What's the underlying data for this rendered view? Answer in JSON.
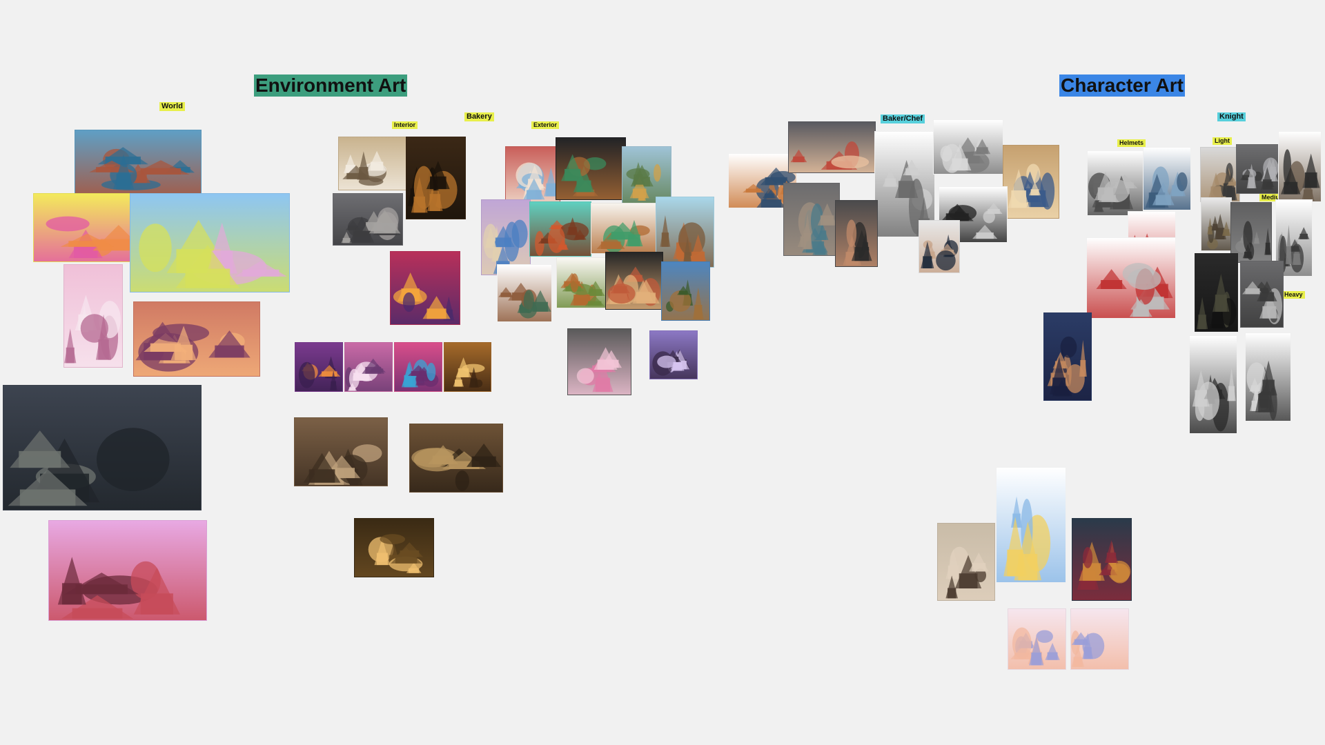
{
  "board": {
    "colors": {
      "background": "#f1f1f1",
      "heading_env": "#3d9e7e",
      "heading_char": "#3b86e6",
      "tag_yellow": "#e8ef4a",
      "tag_cyan": "#57d0dc"
    },
    "headings": {
      "environment": "Environment Art",
      "character": "Character Art"
    },
    "tags": {
      "world": "World",
      "bakery": "Bakery",
      "interior": "Interior",
      "exterior": "Exterior",
      "baker_chef": "Baker/Chef",
      "knight": "Knight",
      "helmets": "Helmets",
      "light": "Light",
      "medium": "Medium",
      "heavy": "Heavy"
    },
    "cards": {
      "world": [
        {
          "subject": "candy-island",
          "colors": [
            "#5f9fc5",
            "#2b6e94",
            "#a9553c"
          ]
        },
        {
          "subject": "cupcake-houses",
          "colors": [
            "#f3ea5c",
            "#f08c46",
            "#e25aa4"
          ]
        },
        {
          "subject": "candy-kingdom",
          "colors": [
            "#8ec6f2",
            "#e2a9d9",
            "#d6e05b"
          ]
        },
        {
          "subject": "pink-street",
          "colors": [
            "#f0c0d8",
            "#b56a92",
            "#f7e6ef"
          ]
        },
        {
          "subject": "candy-village",
          "colors": [
            "#d07a64",
            "#7a3b63",
            "#f3b07a"
          ]
        },
        {
          "subject": "dark-fantasy-city",
          "colors": [
            "#3d4450",
            "#6f7470",
            "#1f2429"
          ]
        },
        {
          "subject": "floating-dessert-island",
          "colors": [
            "#e8a9e3",
            "#6b2a3a",
            "#c74b59"
          ]
        }
      ],
      "interior": [
        {
          "subject": "bakery-layout-sketch",
          "colors": [
            "#c9b38e",
            "#6b5841",
            "#f2ebe0"
          ]
        },
        {
          "subject": "bakery-counter-dark",
          "colors": [
            "#3b2816",
            "#b8742c",
            "#1a120a"
          ]
        },
        {
          "subject": "bakery-isometric-grey",
          "colors": [
            "#6e6e72",
            "#a5a2a0",
            "#3d3d40"
          ]
        },
        {
          "subject": "pastry-shop-window",
          "colors": [
            "#b8305a",
            "#f4a63c",
            "#4b2a6b"
          ]
        },
        {
          "subject": "sweet-shop-1",
          "colors": [
            "#7a3a8e",
            "#f28e3c",
            "#3a1f4f"
          ]
        },
        {
          "subject": "sweet-shop-2",
          "colors": [
            "#c96aa6",
            "#f7e0f0",
            "#6b3b72"
          ]
        },
        {
          "subject": "sweet-shop-3",
          "colors": [
            "#d84e8a",
            "#3aa3d4",
            "#6a2d6f"
          ]
        },
        {
          "subject": "bread-shelves",
          "colors": [
            "#a56a2a",
            "#f2c470",
            "#3a2412"
          ]
        },
        {
          "subject": "bakery-map-1",
          "colors": [
            "#7b6046",
            "#c0a27d",
            "#3c2d20"
          ]
        },
        {
          "subject": "bakery-map-2",
          "colors": [
            "#6d5236",
            "#b8955f",
            "#2e2216"
          ]
        },
        {
          "subject": "cozy-bread-store",
          "colors": [
            "#3a2a14",
            "#f0c070",
            "#6a4c22"
          ]
        }
      ],
      "exterior": [
        {
          "subject": "striped-cottage",
          "colors": [
            "#c95f5a",
            "#7fb0d8",
            "#f2e3d3"
          ]
        },
        {
          "subject": "green-roof-house-dark",
          "colors": [
            "#222326",
            "#3a8b5c",
            "#a86a35"
          ]
        },
        {
          "subject": "storefront-painting",
          "colors": [
            "#9fc3d6",
            "#d2a14a",
            "#5a7a46"
          ]
        },
        {
          "subject": "fairy-castle",
          "colors": [
            "#c0a6d6",
            "#4b7fc2",
            "#e2d0b0"
          ]
        },
        {
          "subject": "orange-cottage-teal",
          "colors": [
            "#5fd0c0",
            "#d2582e",
            "#7a3a20"
          ]
        },
        {
          "subject": "green-roof-shop",
          "colors": [
            "#f7f4ee",
            "#3f9c6a",
            "#b06a32"
          ]
        },
        {
          "subject": "windmill-bakery",
          "colors": [
            "#a9d7ea",
            "#c26a34",
            "#7a5a3a"
          ]
        },
        {
          "subject": "witch-hut",
          "colors": [
            "#ffffff",
            "#3f6b52",
            "#8d5a3a"
          ]
        },
        {
          "subject": "mushroom-houses",
          "colors": [
            "#faf8f3",
            "#b5682e",
            "#6b8a3a"
          ]
        },
        {
          "subject": "brown-roof-bakery",
          "colors": [
            "#262626",
            "#c05a3a",
            "#e2b07a"
          ]
        },
        {
          "subject": "blue-sky-cottage",
          "colors": [
            "#4d86c0",
            "#3a5a2a",
            "#a0703a"
          ]
        },
        {
          "subject": "candy-cottage-grey",
          "colors": [
            "#5a5a5a",
            "#e07aa6",
            "#f2c4d6"
          ]
        },
        {
          "subject": "purple-floating-hut",
          "colors": [
            "#8c78c4",
            "#d6c4f0",
            "#3a2a4a"
          ]
        }
      ],
      "baker_chef": [
        {
          "subject": "pirate-cook",
          "colors": [
            "#ffffff",
            "#2f4e70",
            "#c9783a"
          ]
        },
        {
          "subject": "muscle-bakers",
          "colors": [
            "#5a5a60",
            "#c0473a",
            "#e9c2a0"
          ]
        },
        {
          "subject": "chef-sketches",
          "colors": [
            "#ffffff",
            "#cfcfcf",
            "#6a6a6a"
          ]
        },
        {
          "subject": "chef-lineup",
          "colors": [
            "#ffffff",
            "#d9d9d9",
            "#7a7a7a"
          ]
        },
        {
          "subject": "old-baker-sitting",
          "colors": [
            "#c6a170",
            "#3a5a8a",
            "#f0d9b0"
          ]
        },
        {
          "subject": "wizard-cook",
          "colors": [
            "#6c6c6e",
            "#4a7a8a",
            "#a09080"
          ]
        },
        {
          "subject": "girl-cook",
          "colors": [
            "#4a4a4c",
            "#2a2a2a",
            "#c08a6a"
          ]
        },
        {
          "subject": "chef-apron-sketch",
          "colors": [
            "#ffffff",
            "#cfcfcf",
            "#222222"
          ]
        },
        {
          "subject": "chef-photo",
          "colors": [
            "#e8e8e8",
            "#1f2a3a",
            "#c7a48a"
          ]
        }
      ],
      "knight": [
        {
          "subject": "helmet-sketches",
          "colors": [
            "#ffffff",
            "#bcbcbc",
            "#4a4a4a"
          ]
        },
        {
          "subject": "helmet-grid-blue",
          "colors": [
            "#ffffff",
            "#7fa3c2",
            "#3a5a7a"
          ]
        },
        {
          "subject": "armor-turnaround",
          "colors": [
            "#ffffff",
            "#c9c9c9",
            "#c03030"
          ]
        },
        {
          "subject": "armor-callouts",
          "colors": [
            "#ffffff",
            "#bdbdbd",
            "#c03030"
          ]
        },
        {
          "subject": "light-knight-female",
          "colors": [
            "#d9d9d9",
            "#3a3a3a",
            "#a58a6a"
          ]
        },
        {
          "subject": "light-knight-grey",
          "colors": [
            "#6e6e70",
            "#b0b0b4",
            "#3a3a3a"
          ]
        },
        {
          "subject": "light-knight-dark",
          "colors": [
            "#ffffff",
            "#2a2a2a",
            "#6a5a4a"
          ]
        },
        {
          "subject": "medium-knight-1",
          "colors": [
            "#e9e9e9",
            "#7a6a4a",
            "#4a4032"
          ]
        },
        {
          "subject": "medium-knight-2",
          "colors": [
            "#5f5f60",
            "#2e2e2e",
            "#8a8a8a"
          ]
        },
        {
          "subject": "medium-knight-3",
          "colors": [
            "#ffffff",
            "#3a3a3a",
            "#7a7a7a"
          ]
        },
        {
          "subject": "heavy-knight-dark",
          "colors": [
            "#2a2a2a",
            "#4a4a3a",
            "#121212"
          ]
        },
        {
          "subject": "heavy-knight-grey",
          "colors": [
            "#6a6a6c",
            "#b8b8b8",
            "#3a3a3a"
          ]
        },
        {
          "subject": "knight-sketch-1",
          "colors": [
            "#ffffff",
            "#cfcfcf",
            "#2a2a2a"
          ]
        },
        {
          "subject": "knight-sketch-2",
          "colors": [
            "#ffffff",
            "#d6d6d6",
            "#3a3a3a"
          ]
        },
        {
          "subject": "boxer",
          "colors": [
            "#2b3c66",
            "#c58a5e",
            "#1a2040"
          ]
        }
      ],
      "alice": [
        {
          "subject": "alice-watercolor",
          "colors": [
            "#ffffff",
            "#f2d060",
            "#8ab8e6"
          ]
        },
        {
          "subject": "alice-portrait",
          "colors": [
            "#c9bca8",
            "#4a3a2e",
            "#e0d0bd"
          ]
        },
        {
          "subject": "alice-tea-party",
          "colors": [
            "#2a3a4a",
            "#d08a3a",
            "#8a2a3a"
          ]
        },
        {
          "subject": "pigtail-girl-1",
          "colors": [
            "#f6e6ee",
            "#9a9ed8",
            "#f2b8a0"
          ]
        },
        {
          "subject": "pigtail-girl-2",
          "colors": [
            "#f6e6ee",
            "#9a9ed8",
            "#f2b8a0"
          ]
        }
      ]
    }
  }
}
